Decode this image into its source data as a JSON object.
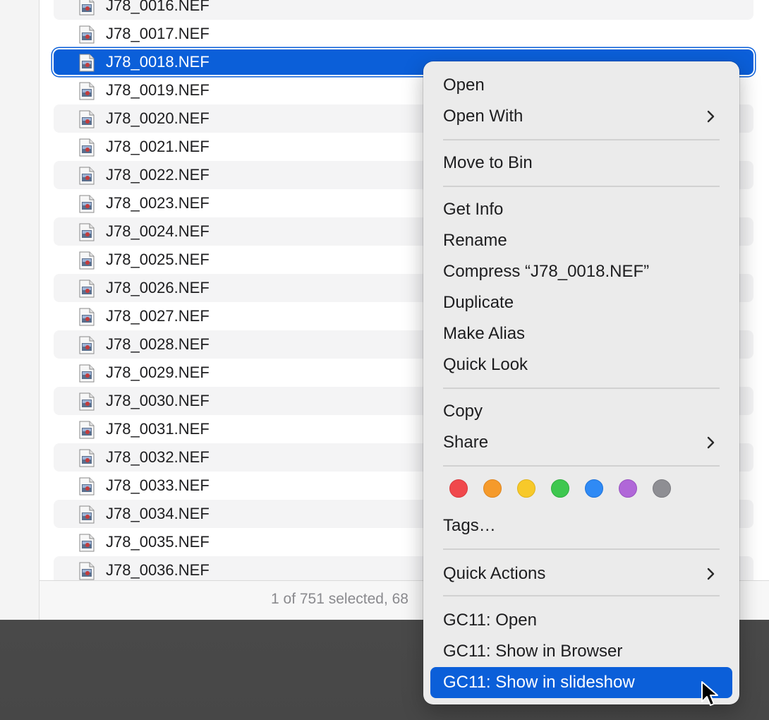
{
  "files": [
    "J78_0016.NEF",
    "J78_0017.NEF",
    "J78_0018.NEF",
    "J78_0019.NEF",
    "J78_0020.NEF",
    "J78_0021.NEF",
    "J78_0022.NEF",
    "J78_0023.NEF",
    "J78_0024.NEF",
    "J78_0025.NEF",
    "J78_0026.NEF",
    "J78_0027.NEF",
    "J78_0028.NEF",
    "J78_0029.NEF",
    "J78_0030.NEF",
    "J78_0031.NEF",
    "J78_0032.NEF",
    "J78_0033.NEF",
    "J78_0034.NEF",
    "J78_0035.NEF",
    "J78_0036.NEF"
  ],
  "selected_file": "J78_0018.NEF",
  "status": {
    "text": "1 of 751 selected, 68"
  },
  "context_menu": {
    "open": "Open",
    "open_with": "Open With",
    "move_to_bin": "Move to Bin",
    "get_info": "Get Info",
    "rename": "Rename",
    "compress": "Compress “J78_0018.NEF”",
    "duplicate": "Duplicate",
    "make_alias": "Make Alias",
    "quick_look": "Quick Look",
    "copy": "Copy",
    "share": "Share",
    "tags": "Tags…",
    "quick_actions": "Quick Actions",
    "gc11_open": "GC11: Open",
    "gc11_show_in_browser": "GC11: Show in Browser",
    "gc11_show_in_slideshow": "GC11: Show in slideshow",
    "highlighted_item": "GC11: Show in slideshow"
  },
  "tag_colors": [
    {
      "name": "red",
      "fill": "#f0484c",
      "stroke": "#d9393d"
    },
    {
      "name": "orange",
      "fill": "#f59a2b",
      "stroke": "#de8620"
    },
    {
      "name": "yellow",
      "fill": "#f7c92a",
      "stroke": "#e0b31c"
    },
    {
      "name": "green",
      "fill": "#3ec74f",
      "stroke": "#2fae3f"
    },
    {
      "name": "blue",
      "fill": "#2f8af5",
      "stroke": "#1f73d9"
    },
    {
      "name": "purple",
      "fill": "#b067d8",
      "stroke": "#9853c0"
    },
    {
      "name": "gray",
      "fill": "#8e8e93",
      "stroke": "#7a7a7f"
    }
  ],
  "accent_color": "#0b5fd9"
}
